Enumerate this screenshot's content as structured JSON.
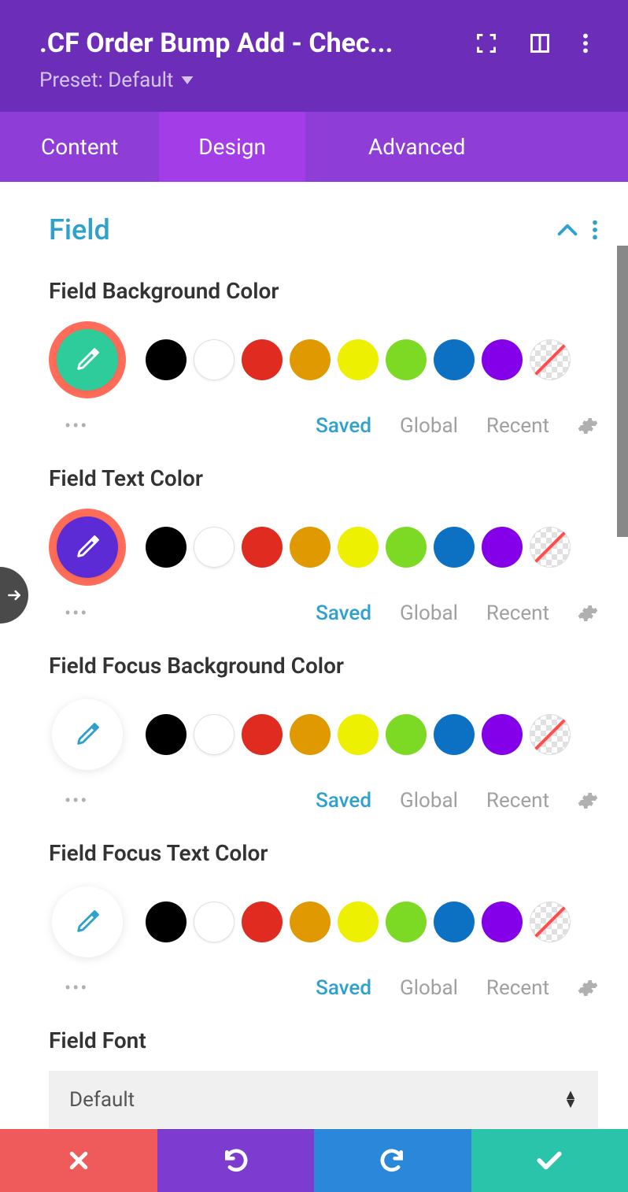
{
  "header": {
    "title": ".CF Order Bump Add - Chec...",
    "preset_label": "Preset: Default"
  },
  "tabs": {
    "content": "Content",
    "design": "Design",
    "advanced": "Advanced"
  },
  "section": {
    "title": "Field"
  },
  "fields": [
    {
      "label": "Field Background Color",
      "picker_bg": "#2ecc9a",
      "picker_icon_color": "#ffffff",
      "highlighted": true,
      "swatches": [
        "#000000",
        "#ffffff",
        "#e02b20",
        "#e09900",
        "#edf000",
        "#7cda24",
        "#0c71c3",
        "#8300e9",
        "transparent"
      ],
      "tabs": {
        "saved": "Saved",
        "global": "Global",
        "recent": "Recent"
      }
    },
    {
      "label": "Field Text Color",
      "picker_bg": "#5c2bd6",
      "picker_icon_color": "#ffffff",
      "highlighted": true,
      "swatches": [
        "#000000",
        "#ffffff",
        "#e02b20",
        "#e09900",
        "#edf000",
        "#7cda24",
        "#0c71c3",
        "#8300e9",
        "transparent"
      ],
      "tabs": {
        "saved": "Saved",
        "global": "Global",
        "recent": "Recent"
      }
    },
    {
      "label": "Field Focus Background Color",
      "picker_bg": "#ffffff",
      "picker_icon_color": "#2ea2cc",
      "highlighted": false,
      "swatches": [
        "#000000",
        "#ffffff",
        "#e02b20",
        "#e09900",
        "#edf000",
        "#7cda24",
        "#0c71c3",
        "#8300e9",
        "transparent"
      ],
      "tabs": {
        "saved": "Saved",
        "global": "Global",
        "recent": "Recent"
      }
    },
    {
      "label": "Field Focus Text Color",
      "picker_bg": "#ffffff",
      "picker_icon_color": "#2ea2cc",
      "highlighted": false,
      "swatches": [
        "#000000",
        "#ffffff",
        "#e02b20",
        "#e09900",
        "#edf000",
        "#7cda24",
        "#0c71c3",
        "#8300e9",
        "transparent"
      ],
      "tabs": {
        "saved": "Saved",
        "global": "Global",
        "recent": "Recent"
      }
    }
  ],
  "font_field": {
    "label": "Field Font",
    "value": "Default"
  }
}
